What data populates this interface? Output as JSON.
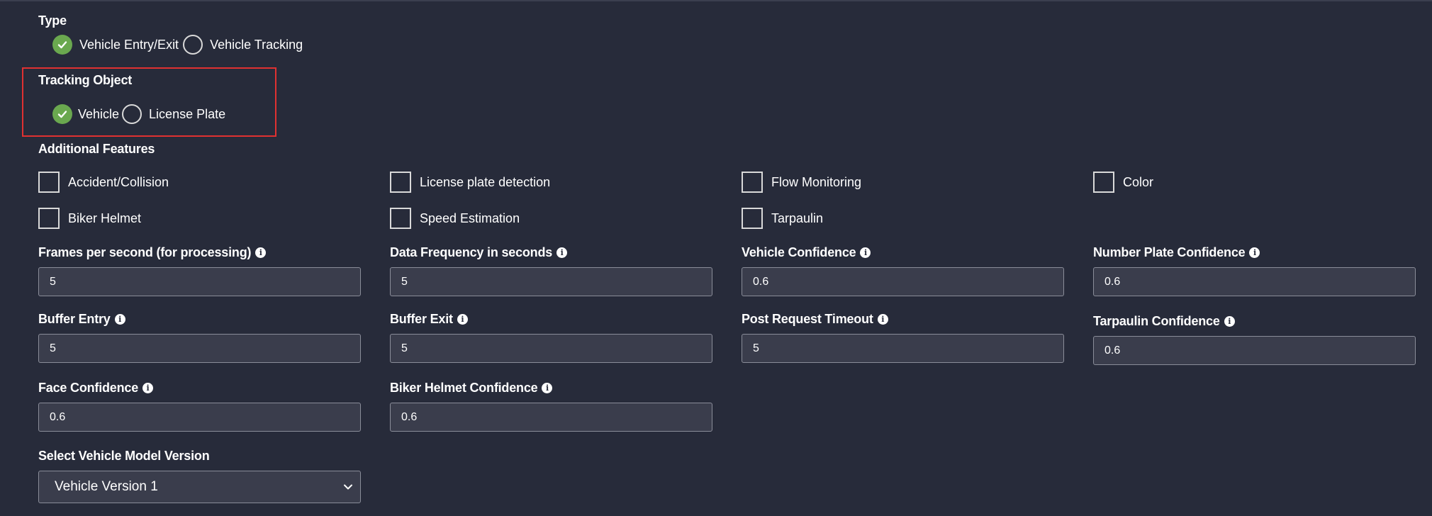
{
  "type_section": {
    "title": "Type",
    "options": [
      {
        "label": "Vehicle Entry/Exit",
        "selected": true
      },
      {
        "label": "Vehicle Tracking",
        "selected": false
      }
    ]
  },
  "tracking_section": {
    "title": "Tracking Object",
    "options": [
      {
        "label": "Vehicle",
        "selected": true
      },
      {
        "label": "License Plate",
        "selected": false
      }
    ]
  },
  "features_section": {
    "title": "Additional Features",
    "row1": [
      "Accident/Collision",
      "License plate detection",
      "Flow Monitoring",
      "Color"
    ],
    "row2": [
      "Biker Helmet",
      "Speed Estimation",
      "Tarpaulin"
    ]
  },
  "fields": {
    "fps": {
      "label": "Frames per second (for processing)",
      "value": "5"
    },
    "data_frequency": {
      "label": "Data Frequency in seconds",
      "value": "5"
    },
    "vehicle_confidence": {
      "label": "Vehicle Confidence",
      "value": "0.6"
    },
    "number_plate_confidence": {
      "label": "Number Plate Confidence",
      "value": "0.6"
    },
    "buffer_entry": {
      "label": "Buffer Entry",
      "value": "5"
    },
    "buffer_exit": {
      "label": "Buffer Exit",
      "value": "5"
    },
    "post_request_timeout": {
      "label": "Post Request Timeout",
      "value": "5"
    },
    "tarpaulin_confidence": {
      "label": "Tarpaulin Confidence",
      "value": "0.6"
    },
    "face_confidence": {
      "label": "Face Confidence",
      "value": "0.6"
    },
    "biker_helmet_confidence": {
      "label": "Biker Helmet Confidence",
      "value": "0.6"
    }
  },
  "model_select": {
    "label": "Select Vehicle Model Version",
    "value": "Vehicle Version 1"
  },
  "colors": {
    "background": "#272b3a",
    "radio_selected": "#6aa84f",
    "highlight_border": "#e03131",
    "input_bg": "#3a3d4c"
  },
  "icons": {
    "info": "info-circle-icon",
    "check": "check-icon",
    "dropdown": "chevron-down-icon"
  }
}
